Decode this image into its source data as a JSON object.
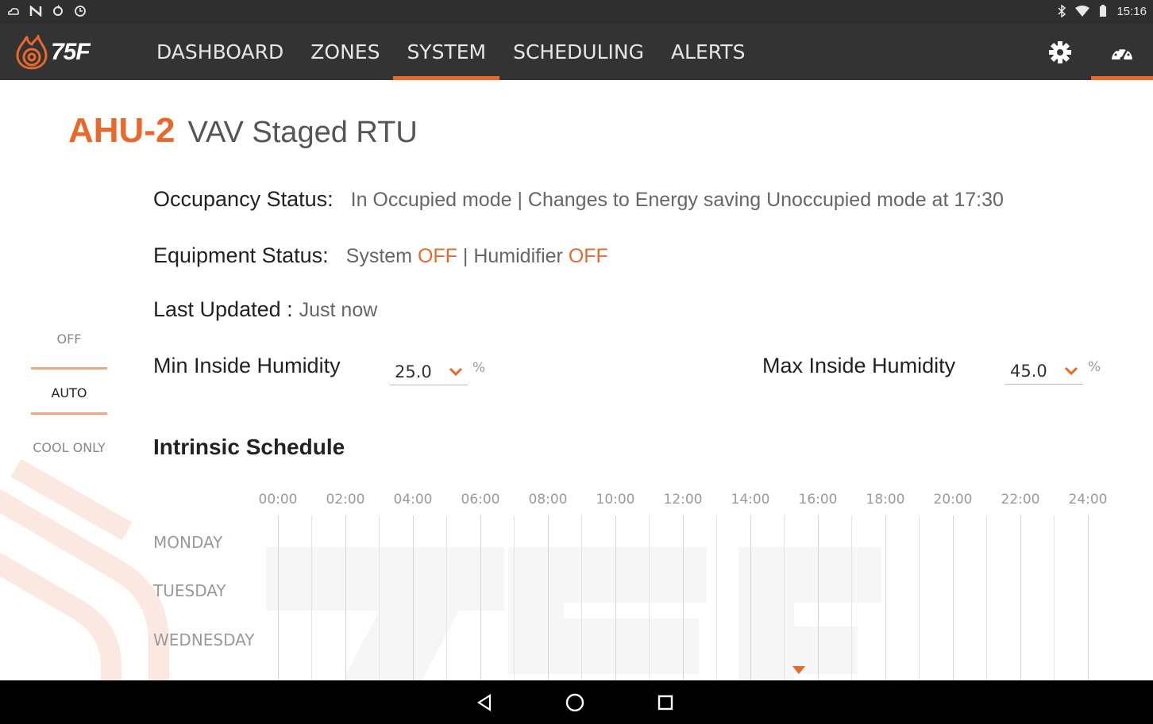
{
  "status_bar": {
    "left_icons": [
      "cloud-outline-icon",
      "n-icon",
      "sync-icon",
      "clock-icon"
    ],
    "right_icons": [
      "bluetooth-icon",
      "wifi-icon",
      "battery-icon"
    ],
    "time": "15:16"
  },
  "app": {
    "logo_text": "75F",
    "brand_color": "#e8692b",
    "nav": [
      {
        "label": "DASHBOARD",
        "active": false
      },
      {
        "label": "ZONES",
        "active": false
      },
      {
        "label": "SYSTEM",
        "active": true
      },
      {
        "label": "SCHEDULING",
        "active": false
      },
      {
        "label": "ALERTS",
        "active": false
      }
    ],
    "actions": [
      {
        "icon": "gear-icon",
        "active": false
      },
      {
        "icon": "gauge-icon",
        "active": true
      }
    ]
  },
  "header": {
    "unit_id": "AHU-2",
    "unit_type": "VAV Staged RTU"
  },
  "status": {
    "occupancy_label": "Occupancy Status:",
    "occupancy_value": "In Occupied mode | Changes to Energy saving Unoccupied mode at 17:30",
    "equipment_label": "Equipment Status:",
    "equipment_system_prefix": "System",
    "equipment_system_state": "OFF",
    "equipment_separator": "| Humidifier",
    "equipment_humidifier_state": "OFF",
    "last_updated_label": "Last Updated :",
    "last_updated_value": "Just now"
  },
  "mode_selector": {
    "options": [
      "OFF",
      "AUTO",
      "COOL ONLY"
    ],
    "selected": "AUTO"
  },
  "humidity": {
    "min_label": "Min Inside Humidity",
    "min_value": "25.0",
    "max_label": "Max Inside Humidity",
    "max_value": "45.0",
    "unit": "%"
  },
  "schedule": {
    "title": "Intrinsic Schedule",
    "hours": [
      "00:00",
      "02:00",
      "04:00",
      "06:00",
      "08:00",
      "10:00",
      "12:00",
      "14:00",
      "16:00",
      "18:00",
      "20:00",
      "22:00",
      "24:00"
    ],
    "days": [
      "MONDAY",
      "TUESDAY",
      "WEDNESDAY"
    ]
  },
  "android_nav": [
    "back-icon",
    "home-icon",
    "recents-icon"
  ]
}
